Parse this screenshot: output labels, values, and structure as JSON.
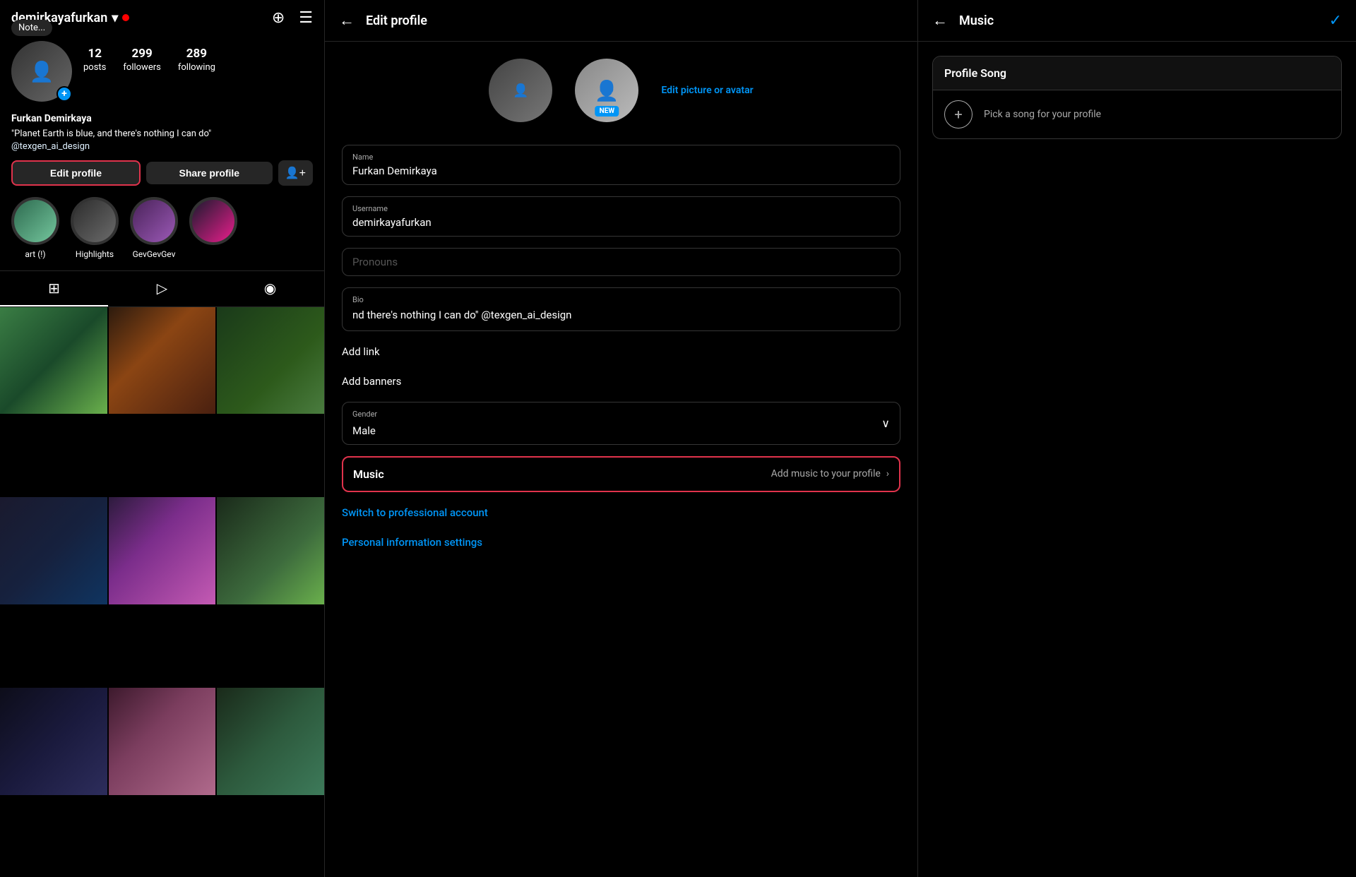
{
  "left": {
    "username": "demirkayafurkan",
    "username_chevron": "▾",
    "note_label": "Note...",
    "stats": {
      "posts_value": "12",
      "posts_label": "posts",
      "followers_value": "299",
      "followers_label": "followers",
      "following_value": "289",
      "following_label": "following"
    },
    "full_name": "Furkan Demirkaya",
    "bio_line1": "\"Planet Earth is blue, and there's nothing I can do\"",
    "bio_link": "@texgen_ai_design",
    "btn_edit": "Edit profile",
    "btn_share": "Share profile",
    "highlights": [
      {
        "label": "art (!)"
      },
      {
        "label": "Highlights"
      },
      {
        "label": "GevGevGev"
      },
      {
        "label": ""
      }
    ],
    "tabs": [
      {
        "icon": "⊞",
        "label": "Grid"
      },
      {
        "icon": "▶",
        "label": "Reels"
      },
      {
        "icon": "◉",
        "label": "Tagged"
      }
    ]
  },
  "middle": {
    "header_back": "←",
    "header_title": "Edit profile",
    "edit_picture_link": "Edit picture or avatar",
    "fields": {
      "name_label": "Name",
      "name_value": "Furkan Demirkaya",
      "username_label": "Username",
      "username_value": "demirkayafurkan",
      "pronouns_label": "Pronouns",
      "pronouns_placeholder": "Pronouns",
      "bio_label": "Bio",
      "bio_value": "nd there's nothing I can do\" @texgen_ai_design"
    },
    "add_link": "Add link",
    "add_banners": "Add banners",
    "gender_label": "Gender",
    "gender_value": "Male",
    "music_label": "Music",
    "music_action": "Add music to your profile",
    "switch_account": "Switch to professional account",
    "personal_info": "Personal information settings"
  },
  "right": {
    "header_back": "←",
    "header_title": "Music",
    "checkmark": "✓",
    "profile_song_title": "Profile Song",
    "pick_song_text": "Pick a song for your profile",
    "plus_icon": "+"
  }
}
